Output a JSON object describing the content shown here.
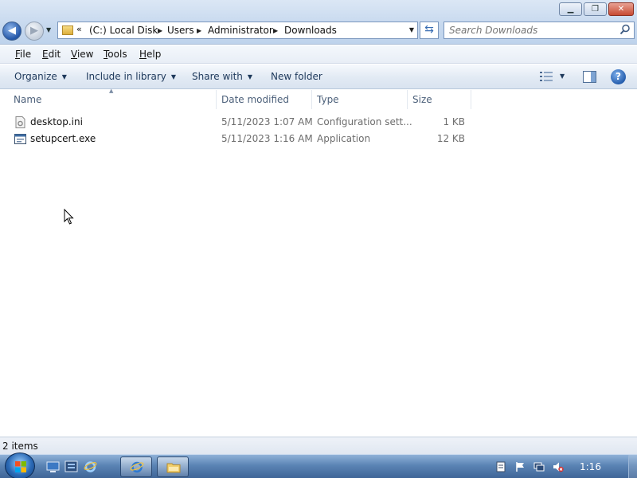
{
  "window": {
    "minimize_label": "▁",
    "maximize_label": "❐",
    "close_label": "✕"
  },
  "navigation": {
    "back_icon": "back-arrow-icon",
    "forward_icon": "forward-arrow-icon",
    "overflow_chevron": "«",
    "breadcrumbs": [
      "(C:) Local Disk",
      "Users",
      "Administrator",
      "Downloads"
    ]
  },
  "search": {
    "placeholder": "Search Downloads"
  },
  "menu": {
    "items": [
      "File",
      "Edit",
      "View",
      "Tools",
      "Help"
    ]
  },
  "toolbar": {
    "organize": "Organize",
    "include_in_library": "Include in library",
    "share_with": "Share with",
    "new_folder": "New folder"
  },
  "columns": {
    "name": "Name",
    "date_modified": "Date modified",
    "type": "Type",
    "size": "Size"
  },
  "files": [
    {
      "name": "desktop.ini",
      "date": "5/11/2023 1:07 AM",
      "type": "Configuration sett...",
      "size": "1 KB",
      "icon": "config-file-icon"
    },
    {
      "name": "setupcert.exe",
      "date": "5/11/2023 1:16 AM",
      "type": "Application",
      "size": "12 KB",
      "icon": "application-icon"
    }
  ],
  "status": {
    "item_count": "2 items"
  },
  "taskbar": {
    "clock": "1:16"
  },
  "colors": {
    "accent": "#1e395b",
    "taskbar": "#5b84b5"
  }
}
